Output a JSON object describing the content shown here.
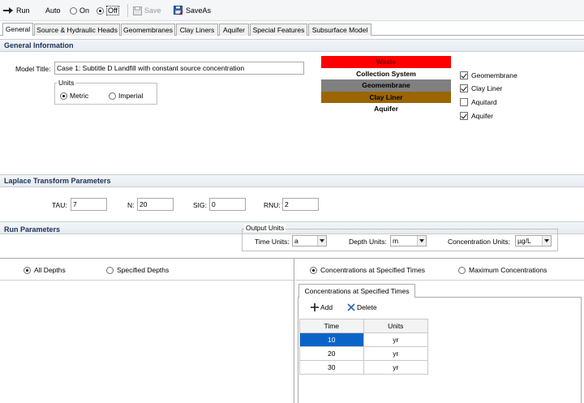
{
  "toolbar": {
    "run_label": "Run",
    "auto_label": "Auto",
    "on_label": "On",
    "off_label": "Off",
    "auto_state": "Off",
    "save_label": "Save",
    "saveas_label": "SaveAs"
  },
  "tabs": [
    {
      "label": "General",
      "active": true
    },
    {
      "label": "Source & Hydraulic Heads",
      "active": false
    },
    {
      "label": "Geomembranes",
      "active": false
    },
    {
      "label": "Clay Liners",
      "active": false
    },
    {
      "label": "Aquifer",
      "active": false
    },
    {
      "label": "Special Features",
      "active": false
    },
    {
      "label": "Subsurface Model",
      "active": false
    }
  ],
  "general": {
    "section_title": "General Information",
    "model_title_label": "Model Title:",
    "model_title_value": "Case 1: Subtitle D Landfill with constant source concentration",
    "units_group_label": "Units",
    "units_metric": "Metric",
    "units_imperial": "Imperial",
    "units_selected": "Metric",
    "layers": [
      {
        "label": "Waste",
        "color": "#ff0000"
      },
      {
        "label": "Collection System",
        "color": "#ffffff"
      },
      {
        "label": "Geomembrane",
        "color": "#808080"
      },
      {
        "label": "Clay Liner",
        "color": "#9b6500"
      },
      {
        "label": "Aquifer",
        "color": "#ffffff"
      }
    ],
    "layer_options": [
      {
        "label": "Geomembrane",
        "checked": true
      },
      {
        "label": "Clay Liner",
        "checked": true
      },
      {
        "label": "Aquitard",
        "checked": false
      },
      {
        "label": "Aquifer",
        "checked": true
      }
    ]
  },
  "laplace": {
    "section_title": "Laplace Transform Parameters",
    "tau_label": "TAU:",
    "tau_value": "7",
    "n_label": "N:",
    "n_value": "20",
    "sig_label": "SIG:",
    "sig_value": "0",
    "rnu_label": "RNU:",
    "rnu_value": "2"
  },
  "run": {
    "section_title": "Run Parameters",
    "output_units_label": "Output Units",
    "time_units_label": "Time Units:",
    "time_units_value": "a",
    "depth_units_label": "Depth Units:",
    "depth_units_value": "m",
    "conc_units_label": "Concentration Units:",
    "conc_units_value": "µg/L"
  },
  "depths": {
    "all_depths": "All Depths",
    "specified_depths": "Specified Depths",
    "selected": "All Depths"
  },
  "concentrations": {
    "at_specified_times": "Concentrations at Specified Times",
    "maximum": "Maximum Concentrations",
    "selected": "Concentrations at Specified Times",
    "subtab_label": "Concentrations at Specified Times",
    "add_label": "Add",
    "delete_label": "Delete",
    "columns": [
      "Time",
      "Units"
    ],
    "rows": [
      {
        "time": "10",
        "units": "yr"
      },
      {
        "time": "20",
        "units": "yr"
      },
      {
        "time": "30",
        "units": "yr"
      }
    ]
  },
  "colors": {
    "section_title": "#19325a",
    "selection": "#0a64c8",
    "add_icon": "#1a1a1a",
    "delete_icon": "#2a5fb0"
  }
}
